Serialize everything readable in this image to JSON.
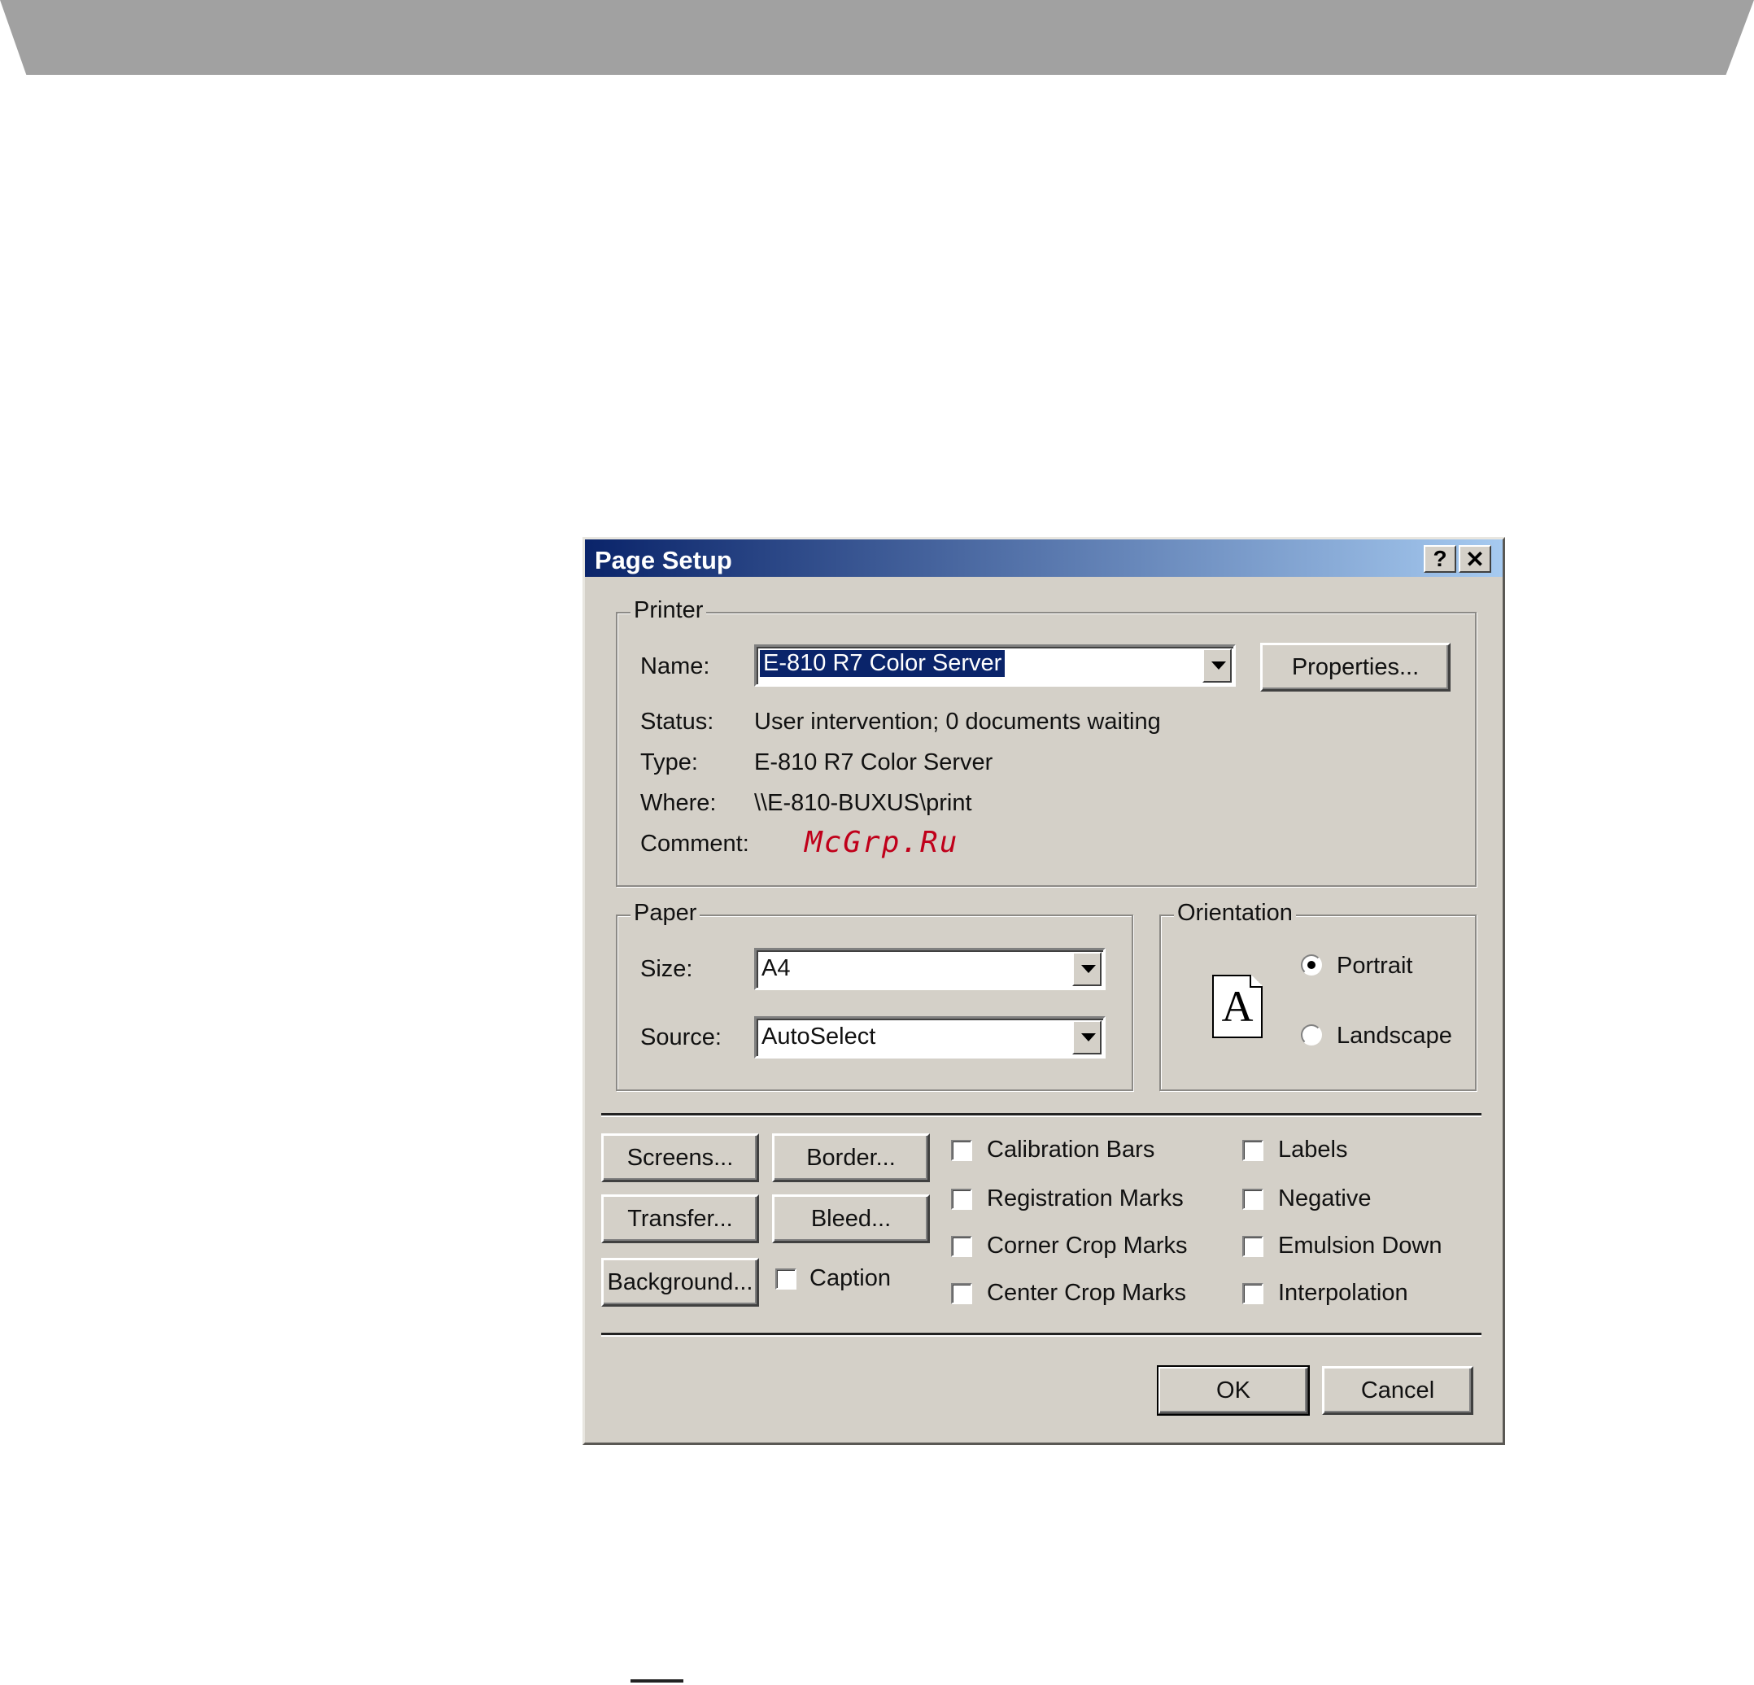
{
  "dialog": {
    "title": "Page Setup",
    "help_label": "?",
    "close_label": "✕"
  },
  "printer": {
    "group_label": "Printer",
    "name_label": "Name:",
    "name_value": "E-810 R7 Color Server",
    "properties_label": "Properties...",
    "status_label": "Status:",
    "status_value": "User intervention; 0 documents waiting",
    "type_label": "Type:",
    "type_value": "E-810 R7 Color Server",
    "where_label": "Where:",
    "where_value": "\\\\E-810-BUXUS\\print",
    "comment_label": "Comment:",
    "comment_value": "McGrp.Ru"
  },
  "paper": {
    "group_label": "Paper",
    "size_label": "Size:",
    "size_value": "A4",
    "source_label": "Source:",
    "source_value": "AutoSelect"
  },
  "orientation": {
    "group_label": "Orientation",
    "icon_letter": "A",
    "portrait_label": "Portrait",
    "landscape_label": "Landscape",
    "selected": "Portrait"
  },
  "buttons": {
    "screens": "Screens...",
    "border": "Border...",
    "transfer": "Transfer...",
    "bleed": "Bleed...",
    "background": "Background...",
    "ok": "OK",
    "cancel": "Cancel"
  },
  "checkboxes": {
    "caption": "Caption",
    "calibration_bars": "Calibration Bars",
    "registration_marks": "Registration Marks",
    "corner_crop_marks": "Corner Crop Marks",
    "center_crop_marks": "Center Crop Marks",
    "labels": "Labels",
    "negative": "Negative",
    "emulsion_down": "Emulsion Down",
    "interpolation": "Interpolation"
  }
}
